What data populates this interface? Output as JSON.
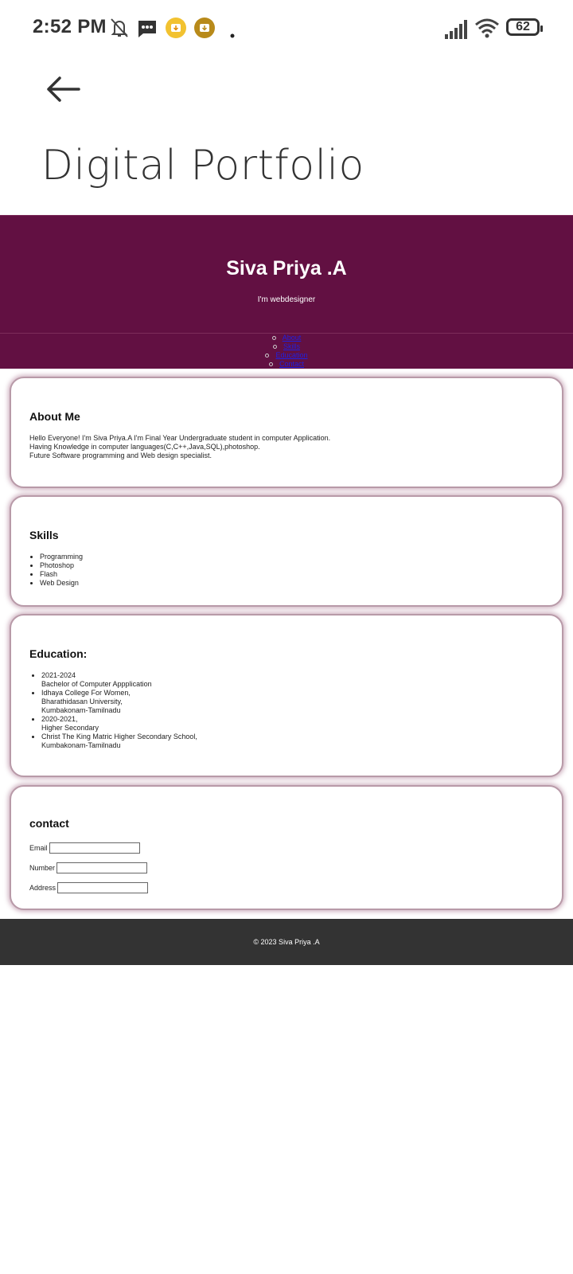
{
  "status": {
    "time": "2:52 PM",
    "battery": "62"
  },
  "appbar": {
    "title": "Digital Portfolio"
  },
  "header": {
    "name": "Siva Priya .A",
    "tagline": "I'm webdesigner"
  },
  "nav": {
    "items": [
      "About",
      "Skills",
      "Education",
      "Contact"
    ]
  },
  "about": {
    "heading": "About Me",
    "lines": [
      "Hello Everyone! I'm Siva Priya.A I'm Final Year Undergraduate student in computer Application.",
      "Having Knowledge in computer languages(C,C++,Java,SQL),photoshop.",
      "Future Software programming and Web design specialist."
    ]
  },
  "skills": {
    "heading": "Skills",
    "items": [
      "Programming",
      "Photoshop",
      "Flash",
      "Web Design"
    ]
  },
  "education": {
    "heading": "Education:",
    "items": [
      [
        "2021-2024",
        "Bachelor of Computer Appplication"
      ],
      [
        "Idhaya College For Women,",
        "Bharathidasan University,",
        "Kumbakonam-Tamilnadu"
      ],
      [
        "2020-2021,",
        "Higher Secondary"
      ],
      [
        "Christ The King Matric Higher Secondary School,",
        "Kumbakonam-Tamilnadu"
      ]
    ]
  },
  "contact": {
    "heading": "contact",
    "email_label": "Email",
    "number_label": "Number",
    "address_label": "Address"
  },
  "footer": {
    "text": "© 2023 Siva Priya .A"
  },
  "colors": {
    "header_bg": "#621042",
    "footer_bg": "#333333",
    "card_border": "#b89aa8"
  }
}
